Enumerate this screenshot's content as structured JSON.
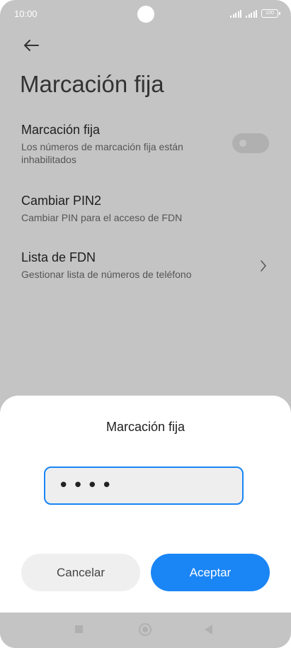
{
  "status_bar": {
    "time": "10:00",
    "battery": "100"
  },
  "page": {
    "title": "Marcación fija"
  },
  "settings": [
    {
      "title": "Marcación fija",
      "description": "Los números de marcación fija están inhabilitados",
      "toggle_on": false
    },
    {
      "title": "Cambiar PIN2",
      "description": "Cambiar PIN para el acceso de FDN"
    },
    {
      "title": "Lista de FDN",
      "description": "Gestionar lista de números de teléfono"
    }
  ],
  "dialog": {
    "title": "Marcación fija",
    "pin_value": "••••",
    "cancel_label": "Cancelar",
    "accept_label": "Aceptar"
  },
  "colors": {
    "accent": "#1a85f5",
    "scrim_background": "#c4c4c4"
  }
}
